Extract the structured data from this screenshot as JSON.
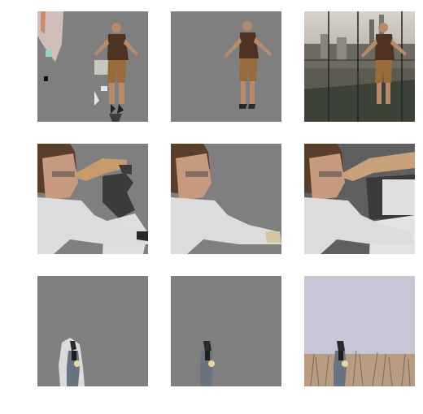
{
  "colors": {
    "masked_background": "#7f7f7f",
    "page_background": "#ffffff"
  },
  "grid": {
    "rows": [
      {
        "subject": "man-on-glass-skywalk",
        "cells": [
          {
            "kind": "mask-coarse"
          },
          {
            "kind": "mask-refined"
          },
          {
            "kind": "original-photo"
          }
        ]
      },
      {
        "subject": "man-at-desk-with-glasses",
        "cells": [
          {
            "kind": "mask-coarse"
          },
          {
            "kind": "mask-refined"
          },
          {
            "kind": "original-photo"
          }
        ]
      },
      {
        "subject": "woman-in-grass-field",
        "cells": [
          {
            "kind": "mask-coarse"
          },
          {
            "kind": "mask-refined"
          },
          {
            "kind": "original-photo"
          }
        ]
      }
    ]
  }
}
